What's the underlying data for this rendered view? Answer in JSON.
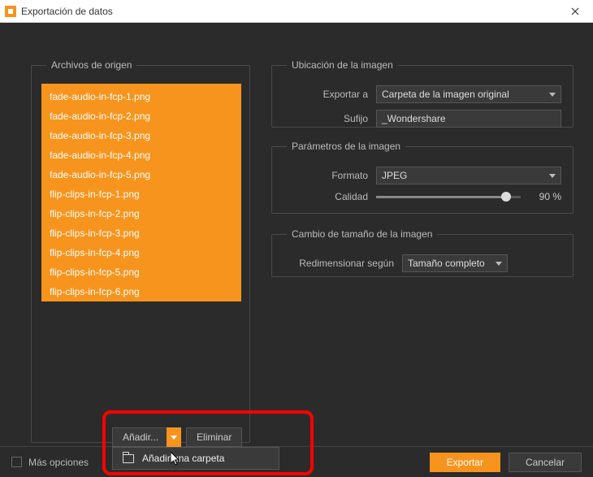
{
  "window": {
    "title": "Exportación de datos"
  },
  "source": {
    "legend": "Archivos de origen",
    "files": [
      "fade-audio-in-fcp-1.png",
      "fade-audio-in-fcp-2.png",
      "fade-audio-in-fcp-3.png",
      "fade-audio-in-fcp-4.png",
      "fade-audio-in-fcp-5.png",
      "flip-clips-in-fcp-1.png",
      "flip-clips-in-fcp-2.png",
      "flip-clips-in-fcp-3.png",
      "flip-clips-in-fcp-4.png",
      "flip-clips-in-fcp-5.png",
      "flip-clips-in-fcp-6.png"
    ]
  },
  "location": {
    "legend": "Ubicación de la imagen",
    "export_label": "Exportar a",
    "export_value": "Carpeta de la imagen original",
    "suffix_label": "Sufijo",
    "suffix_value": "_Wondershare"
  },
  "params": {
    "legend": "Parámetros de la imagen",
    "format_label": "Formato",
    "format_value": "JPEG",
    "quality_label": "Calidad",
    "quality_value": "90 %"
  },
  "resize": {
    "legend": "Cambio de tamaño de la imagen",
    "label": "Redimensionar según",
    "value": "Tamaño completo"
  },
  "buttons": {
    "add": "Añadir...",
    "remove": "Eliminar",
    "dropdown_item": "Añadir una carpeta"
  },
  "footer": {
    "more_options": "Más opciones",
    "export": "Exportar",
    "cancel": "Cancelar"
  },
  "colors": {
    "accent": "#f7941d"
  }
}
